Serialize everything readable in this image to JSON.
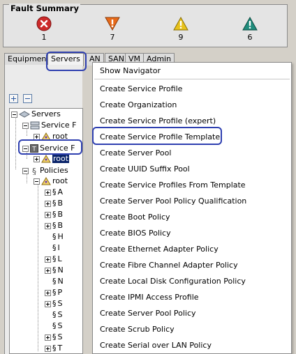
{
  "fault_summary": {
    "title": "Fault Summary",
    "items": [
      {
        "severity": "critical",
        "icon": "critical-x-circle-icon",
        "count": "1",
        "color": "#cc2a2a"
      },
      {
        "severity": "major",
        "icon": "major-triangle-down-icon",
        "count": "7",
        "color": "#e86a1a"
      },
      {
        "severity": "minor",
        "icon": "minor-triangle-icon",
        "count": "9",
        "color": "#e8c21a"
      },
      {
        "severity": "warning",
        "icon": "warning-triangle-icon",
        "count": "6",
        "color": "#1f8c7c"
      }
    ]
  },
  "tabs": [
    "Equipment",
    "Servers",
    "AN",
    "SAN",
    "VM",
    "Admin"
  ],
  "active_tab": "Servers",
  "tree": {
    "nodes": [
      {
        "label": "Servers",
        "icon": "servers-icon"
      },
      {
        "label": "Service F",
        "icon": "service-profiles-icon"
      },
      {
        "label": "root",
        "icon": "org-root-icon"
      },
      {
        "label": "Service F",
        "icon": "service-templates-icon"
      },
      {
        "label": "root",
        "icon": "org-root-icon",
        "selected": true
      },
      {
        "label": "Policies",
        "icon": "policies-icon"
      },
      {
        "label": "root",
        "icon": "org-root-icon"
      }
    ],
    "policy_letters": [
      "A",
      "B",
      "B",
      "B",
      "H",
      "I",
      "L",
      "N",
      "N",
      "P",
      "S",
      "S",
      "S",
      "S",
      "T"
    ]
  },
  "context_menu": {
    "items": [
      "Show Navigator",
      "Create Service Profile",
      "Create Organization",
      "Create Service Profile (expert)",
      "Create Service Profile Template",
      "Create Server Pool",
      "Create UUID Suffix Pool",
      "Create Service Profiles From Template",
      "Create Server Pool Policy Qualification",
      "Create Boot Policy",
      "Create BIOS Policy",
      "Create Ethernet Adapter Policy",
      "Create Fibre Channel Adapter Policy",
      "Create Local Disk Configuration Policy",
      "Create IPMI Access Profile",
      "Create Server Pool Policy",
      "Create Scrub Policy",
      "Create Serial over LAN Policy"
    ],
    "highlighted": "Create Service Profile Template"
  },
  "colors": {
    "highlight_oval": "#2e3fb0",
    "selection": "#0a246a"
  }
}
